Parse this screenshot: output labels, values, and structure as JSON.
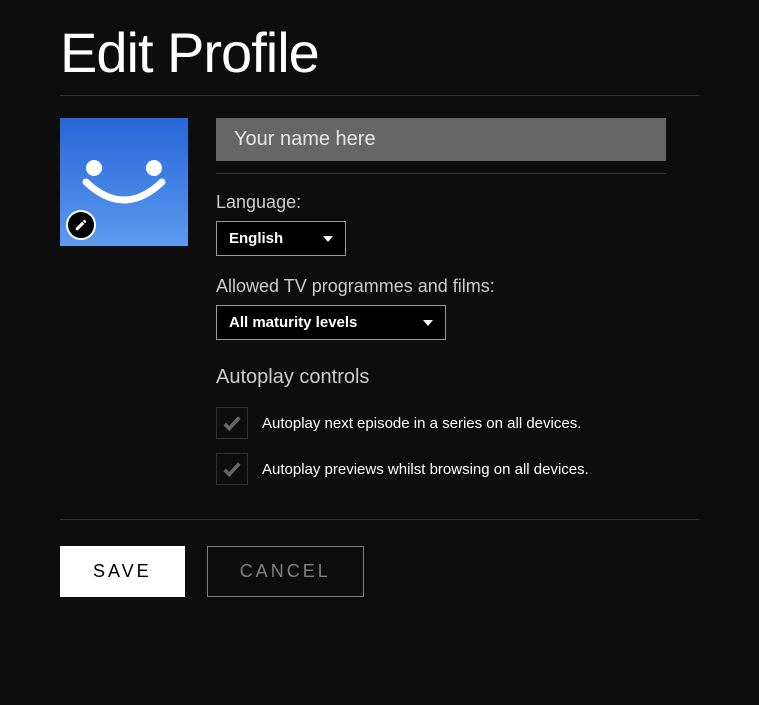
{
  "title": "Edit Profile",
  "name_placeholder": "Your name here",
  "name_value": "",
  "language": {
    "label": "Language:",
    "selected": "English"
  },
  "maturity": {
    "label": "Allowed TV programmes and films:",
    "selected": "All maturity levels"
  },
  "autoplay": {
    "heading": "Autoplay controls",
    "next_episode_label": "Autoplay next episode in a series on all devices.",
    "previews_label": "Autoplay previews whilst browsing on all devices."
  },
  "buttons": {
    "save": "SAVE",
    "cancel": "CANCEL"
  },
  "icons": {
    "edit": "pencil-icon",
    "dropdown": "caret-down-icon",
    "check": "checkmark-icon"
  }
}
